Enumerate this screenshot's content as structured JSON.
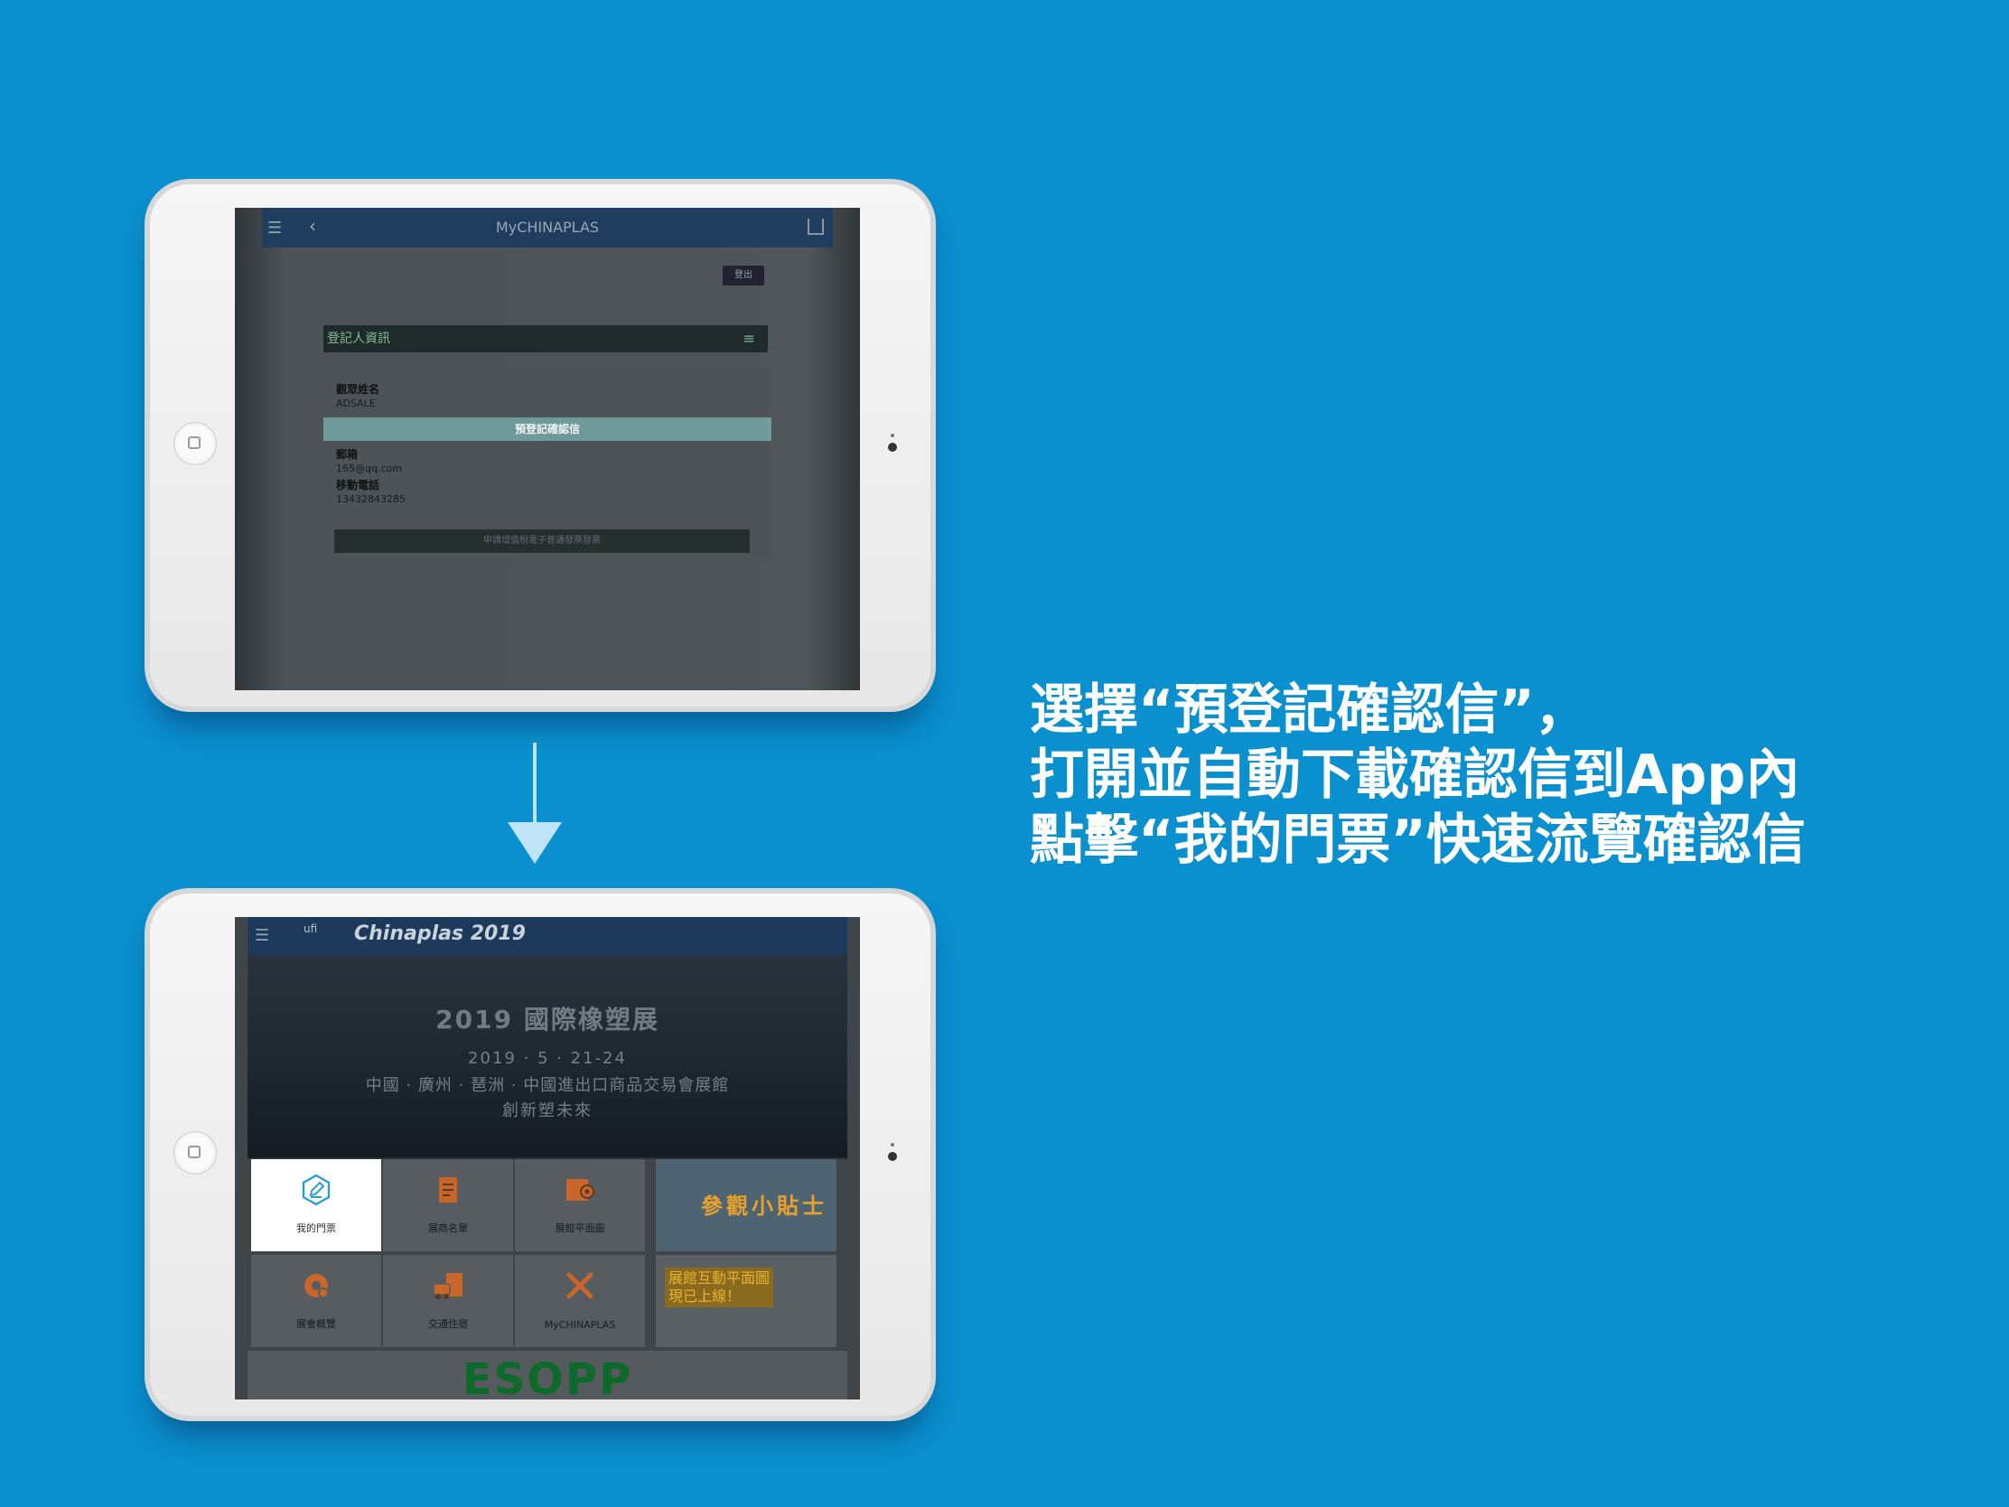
{
  "screen1": {
    "app_title": "MyCHINAPLAS",
    "logout_label": "登出",
    "section_title": "登記人資訊",
    "name_label": "觀眾姓名",
    "name_value": "ADSALE",
    "preconfirm_label": "預登記確認信",
    "email_label": "郵箱",
    "email_value": "165@qq.com",
    "phone_label": "移動電話",
    "phone_value": "13432843285",
    "apply_button": "申請增值稅電子普通發票發票"
  },
  "screen2": {
    "ufi_logo": "ufi",
    "brand": "Chinaplas 2019",
    "hero_title": "2019 國際橡塑展",
    "hero_date": "2019 · 5 · 21-24",
    "hero_venue": "中國 · 廣州 · 琶洲 · 中國進出口商品交易會展館",
    "hero_slogan": "創新塑未來",
    "tiles": [
      {
        "label": "我的門票"
      },
      {
        "label": "展商名單"
      },
      {
        "label": "展館平面圖"
      },
      {
        "label": "展會概覽"
      },
      {
        "label": "交通住宿"
      },
      {
        "label": "MyCHINAPLAS"
      }
    ],
    "tips_label": "參觀小貼士",
    "map_label": "展館互動平面圖現已上線！",
    "esopp": "ESOPP"
  },
  "caption": {
    "line1": "選擇“預登記確認信”，",
    "line2": "打開並自動下載確認信到App內",
    "line3": "點擊“我的門票”快速流覽確認信"
  },
  "colors": {
    "background": "#0a8fcf",
    "tile_icon": "#e07a2a",
    "ticket_icon": "#2a9fd6"
  }
}
